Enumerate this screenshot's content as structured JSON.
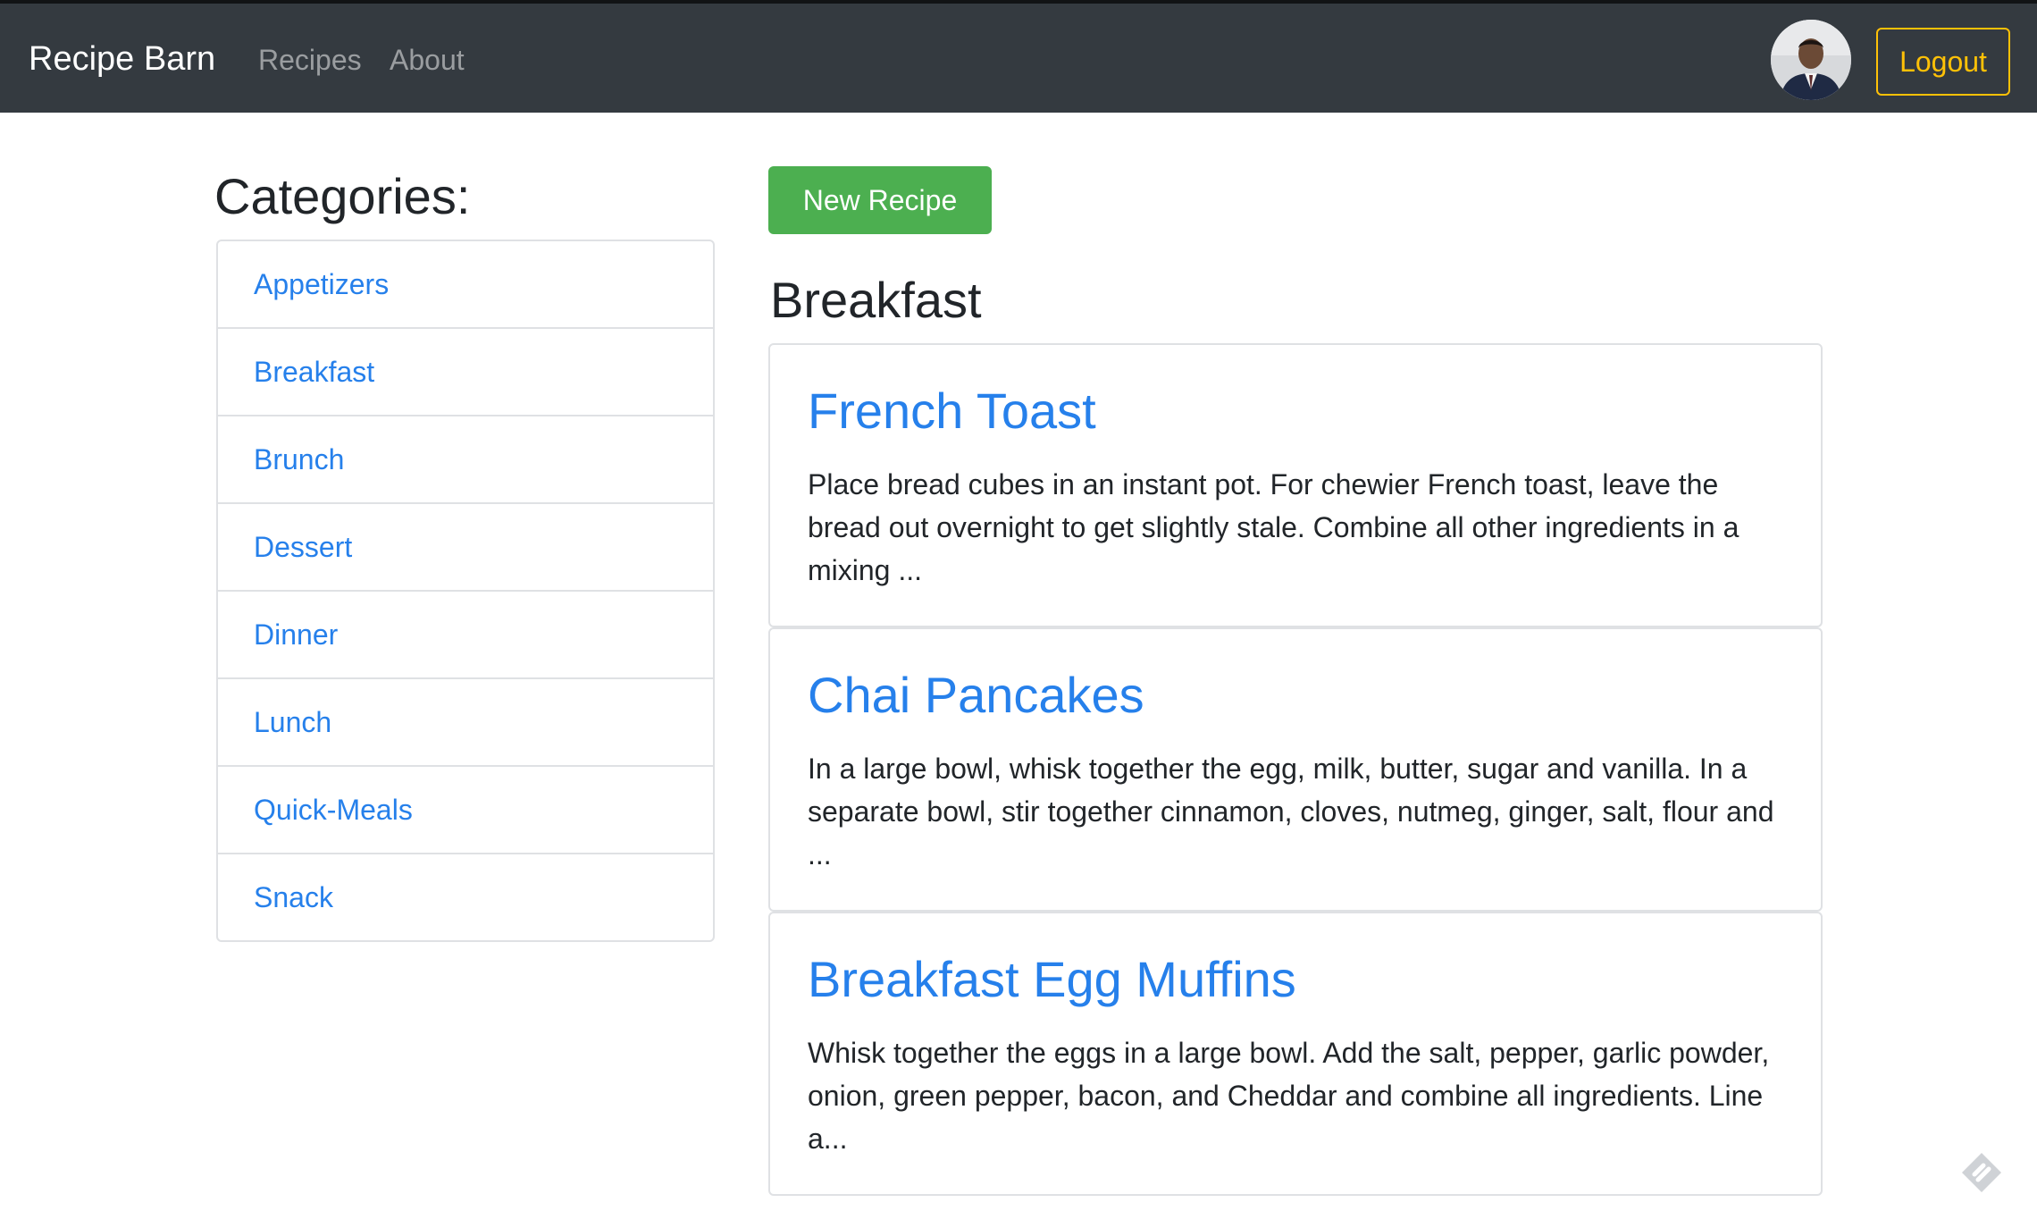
{
  "navbar": {
    "brand": "Recipe Barn",
    "links": [
      "Recipes",
      "About"
    ],
    "logout_label": "Logout"
  },
  "sidebar": {
    "title": "Categories:",
    "items": [
      "Appetizers",
      "Breakfast",
      "Brunch",
      "Dessert",
      "Dinner",
      "Lunch",
      "Quick-Meals",
      "Snack"
    ]
  },
  "main": {
    "new_recipe_label": "New Recipe",
    "section_title": "Breakfast",
    "recipes": [
      {
        "title": "French Toast",
        "text": "Place bread cubes in an instant pot. For chewier French toast, leave the bread out overnight to get slightly stale. Combine all other ingredients in a mixing ..."
      },
      {
        "title": "Chai Pancakes",
        "text": "In a large bowl, whisk together the egg, milk, butter, sugar and vanilla. In a separate bowl, stir together cinnamon, cloves, nutmeg, ginger, salt, flour and ..."
      },
      {
        "title": "Breakfast Egg Muffins",
        "text": "Whisk together the eggs in a large bowl. Add the salt, pepper, garlic powder, onion, green pepper, bacon, and Cheddar and combine all ingredients. Line a..."
      }
    ]
  },
  "colors": {
    "navbar_bg": "#343a40",
    "link_blue": "#2680eb",
    "success_green": "#4caf50",
    "warning_yellow": "#ffc107"
  },
  "icons": {
    "avatar": "user-avatar",
    "corner": "corner-widget-icon"
  }
}
